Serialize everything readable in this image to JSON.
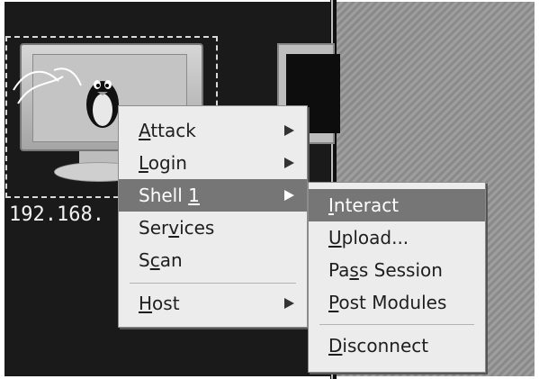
{
  "host": {
    "ip_label": "192.168."
  },
  "context_menu": {
    "items": [
      {
        "pre": "",
        "u": "A",
        "post": "ttack"
      },
      {
        "pre": "",
        "u": "L",
        "post": "ogin"
      },
      {
        "pre": "Shell ",
        "u": "1",
        "post": ""
      },
      {
        "pre": "Ser",
        "u": "v",
        "post": "ices"
      },
      {
        "pre": "S",
        "u": "c",
        "post": "an"
      },
      {
        "pre": "",
        "u": "H",
        "post": "ost"
      }
    ],
    "highlighted": "Shell 1"
  },
  "submenu": {
    "items": [
      {
        "pre": "",
        "u": "I",
        "post": "nteract"
      },
      {
        "pre": "",
        "u": "U",
        "post": "pload..."
      },
      {
        "pre": "Pa",
        "u": "s",
        "post": "s Session"
      },
      {
        "pre": "",
        "u": "P",
        "post": "ost Modules"
      },
      {
        "pre": "",
        "u": "D",
        "post": "isconnect"
      }
    ],
    "highlighted": "Interact"
  },
  "colors": {
    "workspace": "#1a1a1a",
    "menu_background": "#ececec",
    "highlight": "#767676"
  },
  "icons": [
    "host-monitor-icon",
    "tux-icon",
    "lightning-icon",
    "submenu-arrow-icon"
  ]
}
